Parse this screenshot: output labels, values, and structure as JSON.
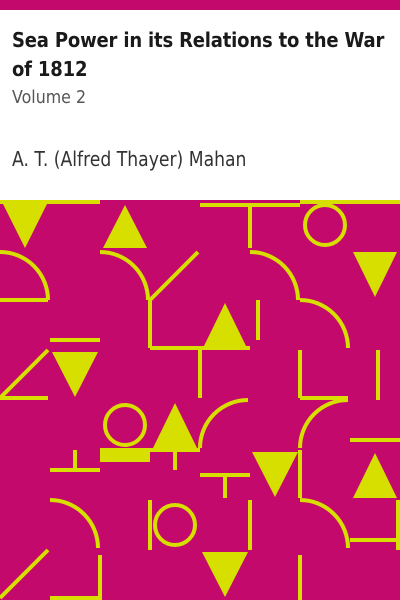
{
  "cover": {
    "title": "Sea Power in its Relations to the War of 1812",
    "subtitle": "Volume 2",
    "author": "A. T. (Alfred Thayer) Mahan"
  },
  "colors": {
    "accent": "#c3096b",
    "pattern_background": "#c3096b",
    "pattern_foreground": "#d6df00"
  }
}
